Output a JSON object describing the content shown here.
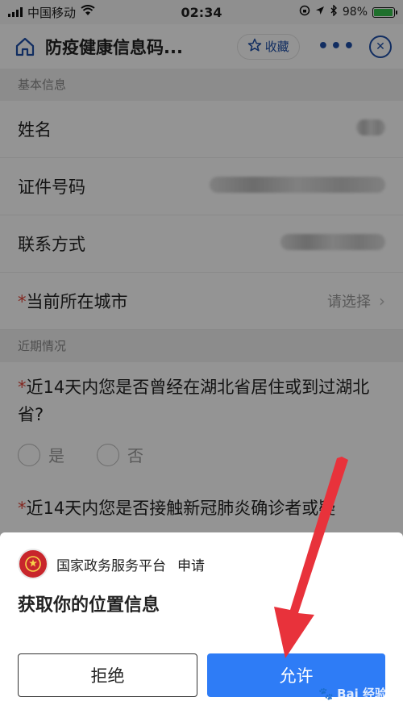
{
  "statusbar": {
    "carrier": "中国移动",
    "time": "02:34",
    "battery": "98%"
  },
  "navbar": {
    "title": "防疫健康信息码...",
    "fav_label": "收藏"
  },
  "sections": {
    "basic_label": "基本信息",
    "recent_label": "近期情况"
  },
  "form": {
    "name_label": "姓名",
    "id_label": "证件号码",
    "contact_label": "联系方式",
    "required_mark": "*",
    "city_label": "当前所在城市",
    "city_placeholder": "请选择",
    "q1": "近14天内您是否曾经在湖北省居住或到过湖北省?",
    "opt_yes": "是",
    "opt_no": "否",
    "q2": "近14天内您是否接触新冠肺炎确诊者或疑"
  },
  "dialog": {
    "app_name": "国家政务服务平台",
    "apply": "申请",
    "emblem_text": "国家政务服务",
    "title": "获取你的位置信息",
    "deny": "拒绝",
    "allow": "允许"
  },
  "watermark": "Bai 经验",
  "colors": {
    "primary": "#1e4fa8",
    "allow_button": "#2e7cf6",
    "required": "#e0463a",
    "arrow": "#e8323b"
  }
}
